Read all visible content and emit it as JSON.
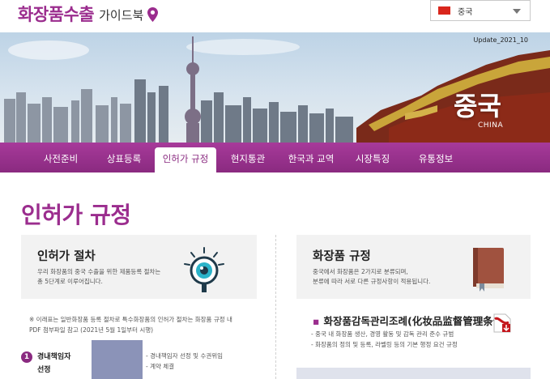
{
  "header": {
    "logo_main": "화장품수출",
    "logo_sub": "가이드북",
    "language": "중국"
  },
  "banner": {
    "update": "Update_2021_10",
    "country": "중국",
    "country_en": "CHINA"
  },
  "nav": {
    "items": [
      {
        "label": "사전준비"
      },
      {
        "label": "상표등록"
      },
      {
        "label": "인허가 규정",
        "active": true
      },
      {
        "label": "현지통관"
      },
      {
        "label": "한국과 교역"
      },
      {
        "label": "시장특징"
      },
      {
        "label": "유통정보"
      }
    ]
  },
  "page": {
    "title": "인허가 규정"
  },
  "card_left": {
    "title": "인허가 절차",
    "desc_line1": "우리 화장품의 중국 수출을 위한 제품등록 절차는",
    "desc_line2": "총 5단계로 이루어집니다.",
    "icon": "magnifier-eye-icon"
  },
  "card_right": {
    "title": "화장품 규정",
    "desc_line1": "중국에서 화장품은 2가지로 분류되며,",
    "desc_line2": "분류에 따라 서로 다른 규정사항이 적용됩니다.",
    "icon": "book-icon"
  },
  "note": {
    "line1": "※ 이래표는 일반화장품 등록 절차로 특수화장품의 인허가 절차는 화장품 규정 내",
    "line2": "PDF 첨부파일 참고 (2021년 5월 1일부터 시행)"
  },
  "step1": {
    "number": "1",
    "title_line1": "경내책임자",
    "title_line2": "선정",
    "detail1": "- 경내책임자 선정 및 수권위임",
    "detail2": "- 계약 체결"
  },
  "regulation": {
    "title": "화장품감독관리조례(化妆品监督管理条例)",
    "detail1": "- 중국 내 화장품 생산, 경영 활동 및 감독 관리 준수 규범",
    "detail2": "- 화장품의 정의 및 등록, 라벨링 등의 기본 행정 요건 규정",
    "icon": "pdf-download-icon"
  },
  "colors": {
    "brand": "#9b2d8e",
    "nav": "#8a2a80",
    "step_bar": "#8b93b8"
  }
}
